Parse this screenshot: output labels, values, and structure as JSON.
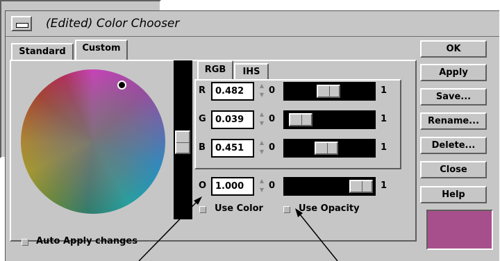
{
  "window": {
    "title": "(Edited) Color Chooser"
  },
  "tabs": {
    "standard": "Standard",
    "custom": "Custom"
  },
  "model_tabs": {
    "rgb": "RGB",
    "ihs": "IHS"
  },
  "channels": [
    {
      "letter": "R",
      "value": "0.482",
      "min": "0",
      "max": "1",
      "level": 0.482
    },
    {
      "letter": "G",
      "value": "0.039",
      "min": "0",
      "max": "1",
      "level": 0.039
    },
    {
      "letter": "B",
      "value": "0.451",
      "min": "0",
      "max": "1",
      "level": 0.451
    }
  ],
  "opacity": {
    "letter": "O",
    "value": "1.000",
    "min": "0",
    "max": "1",
    "level": 1.0
  },
  "use_color": {
    "label": "Use Color",
    "checked": false
  },
  "use_opacity": {
    "label": "Use Opacity",
    "checked": false
  },
  "auto_apply": {
    "label": "Auto Apply changes",
    "checked": false
  },
  "buttons": {
    "ok": "OK",
    "apply": "Apply",
    "save": "Save...",
    "rename": "Rename...",
    "delete": "Delete...",
    "close": "Close",
    "help": "Help"
  },
  "colors": {
    "window_bg": "#c6c6c6",
    "swatch": "#a74f8c",
    "slider_track": "#000000"
  },
  "brightness_level": 0.48,
  "icons": {
    "window_menu": "window-menu-icon",
    "spin": "spin-arrows-icon"
  }
}
